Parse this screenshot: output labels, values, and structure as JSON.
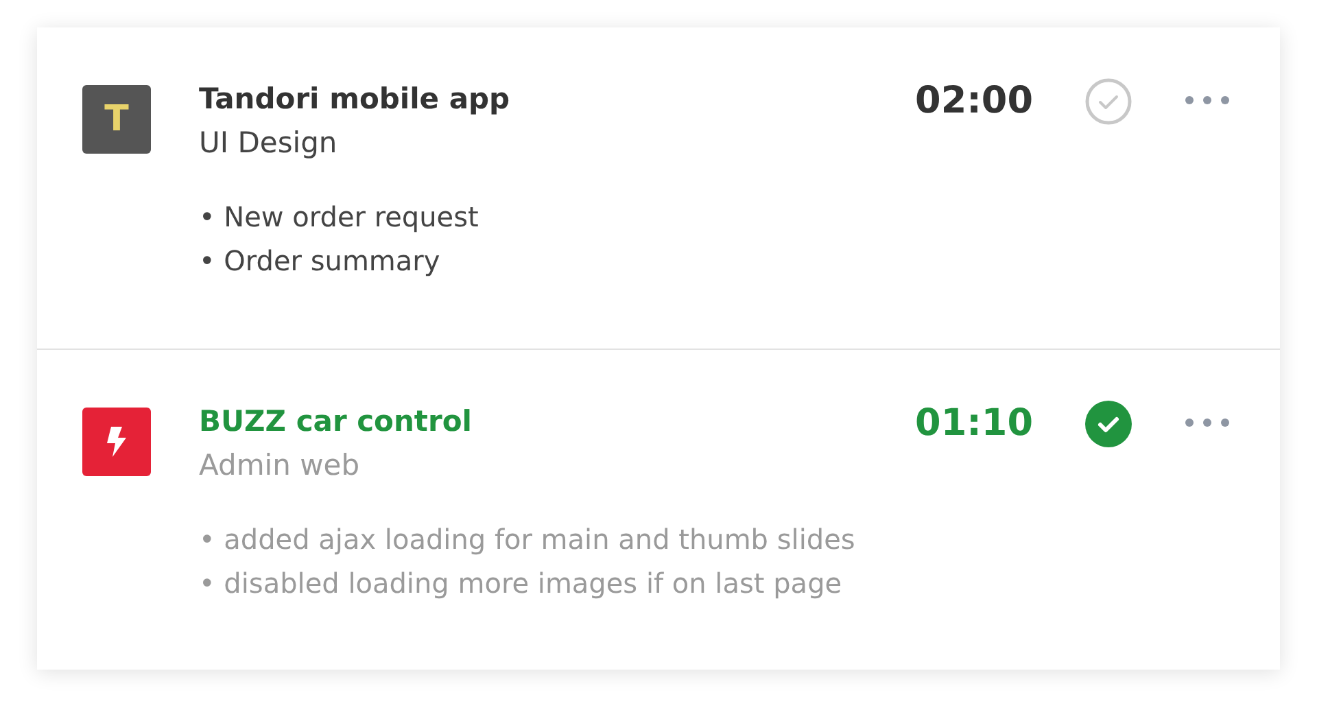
{
  "tasks": [
    {
      "logo": {
        "kind": "letter",
        "text": "T",
        "color": "#555555"
      },
      "title": "Tandori mobile app",
      "subtitle": "UI Design",
      "time": "02:00",
      "completed": false,
      "notes": [
        "• New order request",
        "• Order summary"
      ]
    },
    {
      "logo": {
        "kind": "bolt",
        "color": "#e52237"
      },
      "title": "BUZZ car control",
      "subtitle": "Admin web",
      "time": "01:10",
      "completed": true,
      "notes": [
        "• added ajax loading for main and thumb slides",
        "• disabled loading more images if on last page"
      ]
    }
  ]
}
